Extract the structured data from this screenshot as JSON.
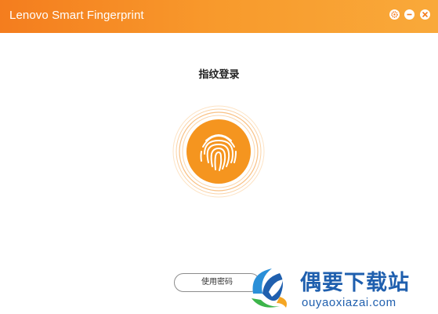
{
  "window": {
    "title": "Lenovo Smart Fingerprint",
    "accent_start": "#f47d1e",
    "accent_end": "#f9a93a",
    "controls": [
      {
        "icon": "gear-icon"
      },
      {
        "icon": "minimize-icon"
      },
      {
        "icon": "close-icon"
      }
    ]
  },
  "main": {
    "title": "指纹登录",
    "fingerprint_icon": "fingerprint-icon",
    "fingerprint_color": "#f5951f",
    "password_button_label": "使用密码"
  },
  "watermark": {
    "text_cn": "偶要下载站",
    "text_en": "ouyaoxiazai.com",
    "color": "#1f5fae"
  }
}
